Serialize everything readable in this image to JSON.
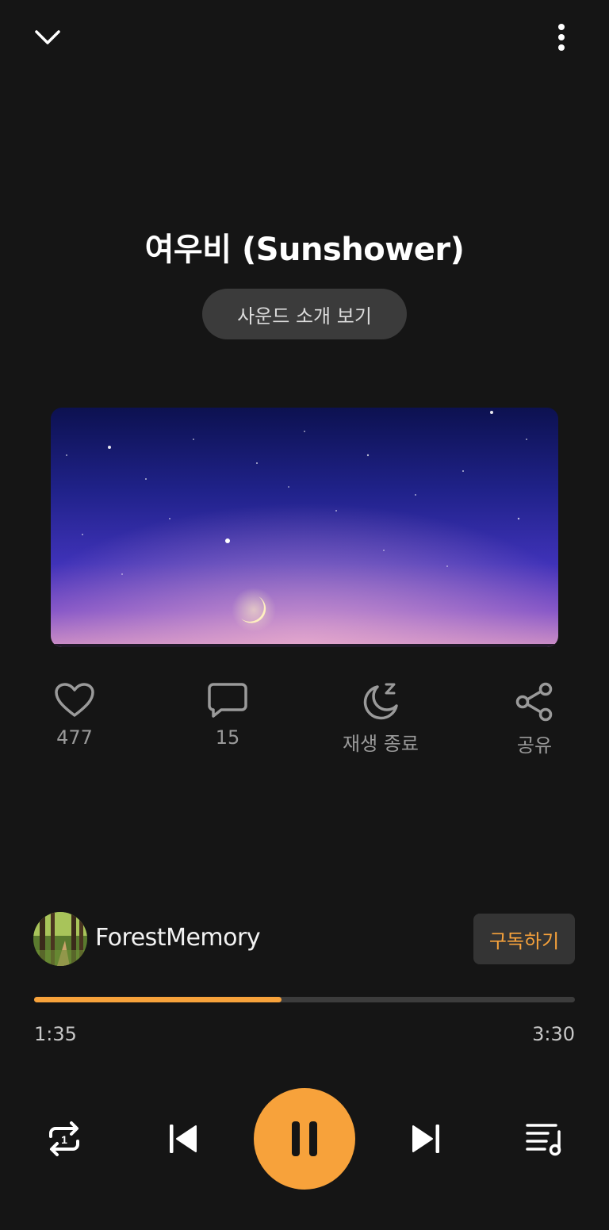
{
  "header": {
    "collapse_icon": "chevron-down-icon",
    "menu_icon": "more-vertical-icon"
  },
  "track": {
    "title": "여우비 (Sunshower)",
    "intro_button_label": "사운드 소개 보기"
  },
  "actions": {
    "like": {
      "icon": "heart-icon",
      "label": "477"
    },
    "comment": {
      "icon": "comment-icon",
      "label": "15"
    },
    "sleep_timer": {
      "icon": "moon-sleep-icon",
      "label": "재생 종료"
    },
    "share": {
      "icon": "share-icon",
      "label": "공유"
    }
  },
  "creator": {
    "name": "ForestMemory",
    "subscribe_label": "구독하기"
  },
  "progress": {
    "elapsed": "1:35",
    "total": "3:30",
    "fraction": 0.457
  },
  "controls": {
    "repeat_icon": "repeat-one-icon",
    "previous_icon": "skip-previous-icon",
    "play_pause_icon": "pause-icon",
    "next_icon": "skip-next-icon",
    "playlist_icon": "playlist-music-icon"
  },
  "colors": {
    "background": "#151515",
    "accent": "#f7a23b",
    "secondary_text": "#9a9a9a"
  }
}
